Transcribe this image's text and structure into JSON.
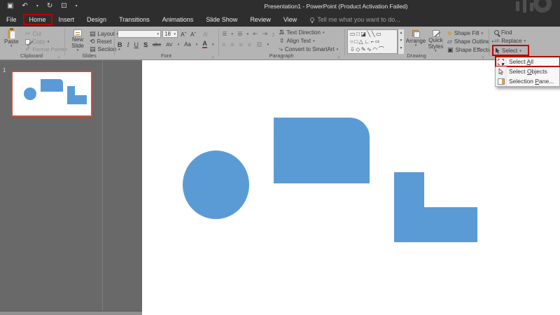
{
  "titlebar": {
    "title": "Presentation1 - PowerPoint (Product Activation Failed)"
  },
  "tabs": {
    "file": "File",
    "home": "Home",
    "insert": "Insert",
    "design": "Design",
    "transitions": "Transitions",
    "animations": "Animations",
    "slideshow": "Slide Show",
    "review": "Review",
    "view": "View",
    "tellme": "Tell me what you want to do..."
  },
  "ribbon": {
    "clipboard": {
      "label": "Clipboard",
      "paste": "Paste",
      "cut": "Cut",
      "copy": "Copy",
      "format_painter": "Format Painter"
    },
    "slides": {
      "label": "Slides",
      "new_slide": "New Slide",
      "layout": "Layout",
      "reset": "Reset",
      "section": "Section"
    },
    "font": {
      "label": "Font",
      "font_name": "",
      "font_size": "18",
      "bold": "B",
      "italic": "I",
      "underline": "U",
      "shadow": "S",
      "strikethrough": "abc",
      "char_spacing": "AV",
      "change_case": "Aa",
      "font_color": "A"
    },
    "paragraph": {
      "label": "Paragraph",
      "text_direction": "Text Direction",
      "align_text": "Align Text",
      "convert_smartart": "Convert to SmartArt"
    },
    "drawing": {
      "label": "Drawing",
      "arrange": "Arrange",
      "quick_styles": "Quick Styles",
      "shape_fill": "Shape Fill",
      "shape_outline": "Shape Outline",
      "shape_effects": "Shape Effects"
    },
    "editing": {
      "find": "Find",
      "replace": "Replace",
      "select": "Select"
    }
  },
  "select_menu": {
    "select_all": {
      "pre": "Select ",
      "key": "A",
      "post": "ll"
    },
    "select_objects": {
      "pre": "Select ",
      "key": "O",
      "post": "bjects"
    },
    "selection_pane": {
      "pre": "Selection ",
      "key": "P",
      "post": "ane..."
    }
  },
  "slide_panel": {
    "slide_number": "1"
  },
  "canvas": {
    "shapes": [
      "ellipse",
      "round-single-corner-rectangle",
      "l-shape"
    ],
    "shape_fill_color": "#5b9bd5"
  },
  "colors": {
    "annotation_red": "#c00000",
    "shape_blue": "#5b9bd5",
    "thumbnail_border": "#c8503e",
    "ribbon_bg": "#b4b4b4",
    "titlebar_bg": "#2e2e2e",
    "panel_bg": "#696969"
  },
  "icons": {
    "save": "▣",
    "undo": "↶",
    "redo": "↻",
    "dropdown": "▾",
    "cut": "✂",
    "format_painter": "✐",
    "reset": "⟲",
    "layout": "▤",
    "section": "▤",
    "font_grow": "Aˆ",
    "font_shrink": "Aˇ",
    "clear_format": "A̸",
    "bullets": "≣",
    "numbering": "≣",
    "indent_dec": "⇤",
    "indent_inc": "⇥",
    "line_spacing": "↕",
    "align_left": "≡",
    "align_center": "≡",
    "align_right": "≡",
    "justify": "≡",
    "columns": "▥",
    "text_direction": "⇅",
    "align_text": "⇳",
    "smartart": "⤷",
    "shape_fill": "◆",
    "shape_outline": "▱",
    "shape_effects": "▣",
    "replace": "ab",
    "gallery_row1": "▭□◪╲╲▭",
    "gallery_row2": "○□△∟⌐⇨",
    "gallery_row3": "⇩◇✎∿◠⌒",
    "gallery_up": "▲",
    "gallery_down": "▼",
    "gallery_more": "▼",
    "launcher": "⌟",
    "qat_screen": "⊡"
  }
}
